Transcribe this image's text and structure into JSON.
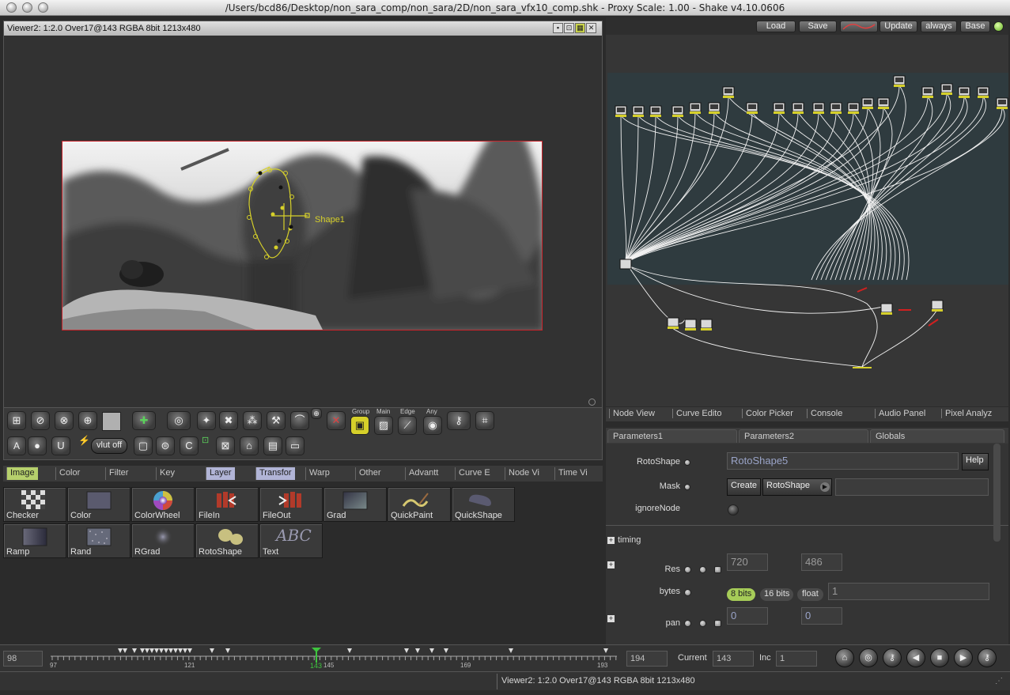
{
  "window": {
    "title": "/Users/bcd86/Desktop/non_sara_comp/non_sara/2D/non_sara_vfx10_comp.shk - Proxy Scale: 1.00 - Shake v4.10.0606"
  },
  "viewer": {
    "header": "Viewer2: 1:2.0 Over17@143 RGBA 8bit 1213x480",
    "shape_label": "Shape1",
    "toolbar": {
      "vlut_label": "vlut off",
      "group_label": "Group",
      "main_label": "Main",
      "edge_label": "Edge",
      "any_label": "Any",
      "text_tool_label": "A"
    }
  },
  "tool_tabs": [
    {
      "label": "Image",
      "selected": true
    },
    {
      "label": "Color"
    },
    {
      "label": "Filter"
    },
    {
      "label": "Key"
    },
    {
      "label": "Layer"
    },
    {
      "label": "Transfor"
    },
    {
      "label": "Warp"
    },
    {
      "label": "Other"
    },
    {
      "label": "Advantt"
    },
    {
      "label": "Curve E"
    },
    {
      "label": "Node Vi"
    },
    {
      "label": "Time Vi"
    }
  ],
  "tools": [
    {
      "label": "Checker",
      "icon": "checker-icon"
    },
    {
      "label": "Color",
      "icon": "color-swatch-icon"
    },
    {
      "label": "ColorWheel",
      "icon": "color-wheel-icon"
    },
    {
      "label": "FileIn",
      "icon": "film-in-icon"
    },
    {
      "label": "FileOut",
      "icon": "film-out-icon"
    },
    {
      "label": "Grad",
      "icon": "gradient-icon"
    },
    {
      "label": "QuickPaint",
      "icon": "brush-icon"
    },
    {
      "label": "QuickShape",
      "icon": "shape-icon"
    },
    {
      "label": "Ramp",
      "icon": "ramp-icon"
    },
    {
      "label": "Rand",
      "icon": "noise-icon"
    },
    {
      "label": "RGrad",
      "icon": "radial-gradient-icon"
    },
    {
      "label": "RotoShape",
      "icon": "rotoshape-icon"
    },
    {
      "label": "Text",
      "icon": "text-icon",
      "glyph": "ABC"
    }
  ],
  "node_toolbar": {
    "load": "Load",
    "save": "Save",
    "update": "Update",
    "always": "always",
    "base": "Base"
  },
  "pane_tabs": [
    "Node View",
    "Curve Edito",
    "Color Picker",
    "Console",
    "Audio Panel",
    "Pixel Analyz"
  ],
  "param_tabs": [
    "Parameters1",
    "Parameters2",
    "Globals"
  ],
  "params": {
    "rotoshape_label": "RotoShape",
    "rotoshape_value": "RotoShape5",
    "help": "Help",
    "mask_label": "Mask",
    "create": "Create",
    "mask_value": "RotoShape",
    "ignore_label": "ignoreNode",
    "timing_label": "timing",
    "res_label": "Res",
    "res_w": "720",
    "res_h": "486",
    "bytes_label": "bytes",
    "bits8": "8 bits",
    "bits16": "16 bits",
    "float": "float",
    "bytes_value": "1",
    "pan_label": "pan",
    "pan_x": "0",
    "pan_y": "0"
  },
  "timeline": {
    "start": "98",
    "end": "194",
    "current_label": "Current",
    "current_value": "143",
    "inc_label": "Inc",
    "inc_value": "1",
    "ticks": [
      "97",
      "121",
      "143",
      "145",
      "169",
      "193"
    ]
  },
  "status": {
    "text": "Viewer2: 1:2.0 Over17@143 RGBA 8bit 1213x480"
  },
  "colors": {
    "selected_tab": "#b6d06c",
    "image_border": "#c8232a",
    "roto_shape": "#d6d02a",
    "playhead": "#3ec43e"
  }
}
